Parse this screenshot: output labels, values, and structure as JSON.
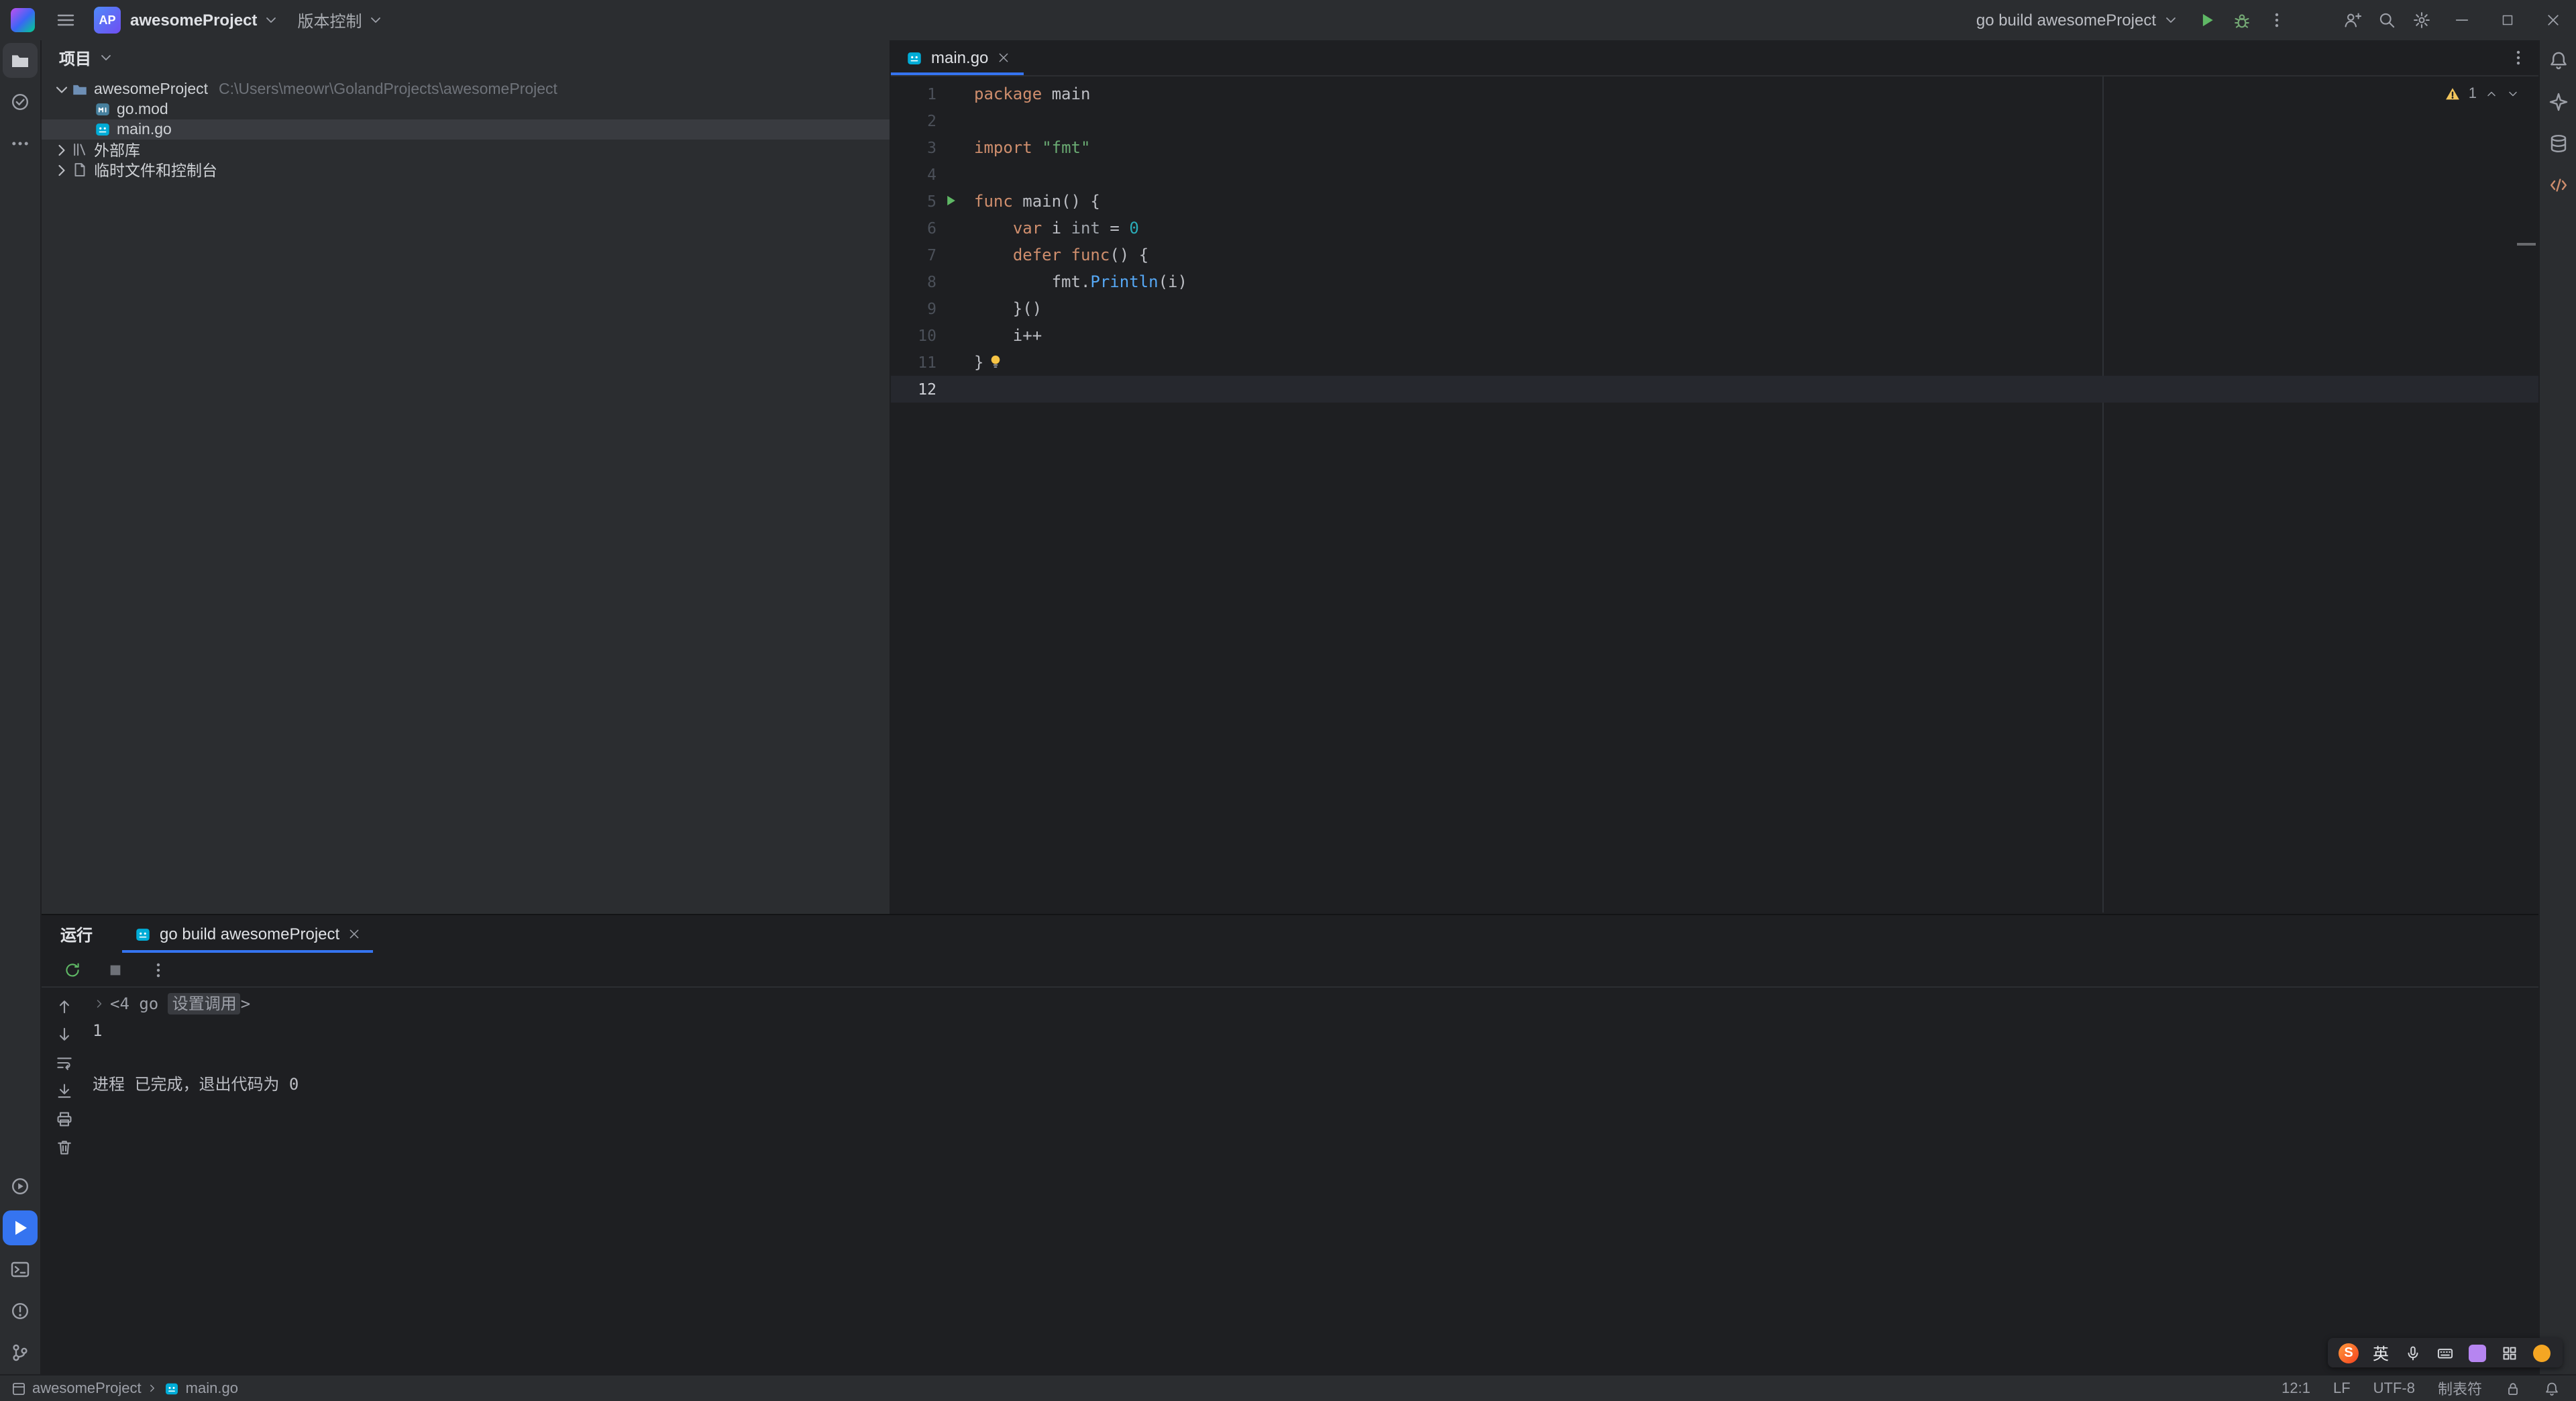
{
  "colors": {
    "accent": "#3574f0",
    "run_green": "#5fb865",
    "warning": "#f2c55c",
    "go_cyan": "#00acd7",
    "selection": "#393b40"
  },
  "title_bar": {
    "project_badge": "AP",
    "project_name": "awesomeProject",
    "vcs_label": "版本控制",
    "run_config_label": "go build awesomeProject",
    "left_icons": [
      "goland-logo",
      "hamburger-icon",
      "chevron-down-icon"
    ],
    "right_icons": [
      "run-icon",
      "debug-icon",
      "more-vertical-icon",
      "code-with-me-icon",
      "search-icon",
      "settings-icon",
      "minimize-icon",
      "maximize-icon",
      "close-icon"
    ]
  },
  "left_toolbar": {
    "top": [
      {
        "icon": "project-folder-icon",
        "active": true
      },
      {
        "icon": "commit-icon",
        "active": false
      },
      {
        "icon": "more-horizontal-icon",
        "active": false
      }
    ],
    "bottom": [
      {
        "icon": "services-icon",
        "active": false
      },
      {
        "icon": "run-icon",
        "active": true,
        "accent": true
      },
      {
        "icon": "terminal-icon",
        "active": false
      },
      {
        "icon": "problems-icon",
        "active": false
      },
      {
        "icon": "git-icon",
        "active": false
      }
    ]
  },
  "right_toolbar": [
    {
      "icon": "notifications-icon"
    },
    {
      "icon": "ai-assistant-icon"
    },
    {
      "icon": "database-icon"
    },
    {
      "icon": "endpoints-icon"
    }
  ],
  "project_panel": {
    "header": "项目",
    "tree": [
      {
        "depth": 0,
        "chevron": "down",
        "icon": "folder-icon",
        "label": "awesomeProject",
        "path": "C:\\Users\\meowr\\GolandProjects\\awesomeProject",
        "selected": false
      },
      {
        "depth": 1,
        "chevron": "",
        "icon": "go-mod-icon",
        "label": "go.mod",
        "path": "",
        "selected": false
      },
      {
        "depth": 1,
        "chevron": "",
        "icon": "go-file-icon",
        "label": "main.go",
        "path": "",
        "selected": true
      },
      {
        "depth": 0,
        "chevron": "right",
        "icon": "library-icon",
        "label": "外部库",
        "path": "",
        "selected": false
      },
      {
        "depth": 0,
        "chevron": "right",
        "icon": "scratches-icon",
        "label": "临时文件和控制台",
        "path": "",
        "selected": false
      }
    ]
  },
  "editor": {
    "tab": {
      "icon": "go-file-icon",
      "label": "main.go",
      "close_icon": "close-icon"
    },
    "inspect_widget": {
      "warning_icon": "warning-icon",
      "warning_count": "1"
    },
    "caret_line": 12,
    "code": [
      {
        "n": 1,
        "tok": [
          [
            "kw",
            "package"
          ],
          [
            "pl",
            " main"
          ]
        ]
      },
      {
        "n": 2,
        "tok": []
      },
      {
        "n": 3,
        "tok": [
          [
            "kw",
            "import"
          ],
          [
            "pl",
            " "
          ],
          [
            "str",
            "\"fmt\""
          ]
        ]
      },
      {
        "n": 4,
        "tok": []
      },
      {
        "n": 5,
        "run": true,
        "tok": [
          [
            "kw",
            "func"
          ],
          [
            "pl",
            " main() {"
          ]
        ]
      },
      {
        "n": 6,
        "tok": [
          [
            "pl",
            "    "
          ],
          [
            "kw",
            "var"
          ],
          [
            "pl",
            " i "
          ],
          [
            "ty",
            "int"
          ],
          [
            "pl",
            " = "
          ],
          [
            "num",
            "0"
          ]
        ]
      },
      {
        "n": 7,
        "tok": [
          [
            "pl",
            "    "
          ],
          [
            "kw",
            "defer"
          ],
          [
            "pl",
            " "
          ],
          [
            "kw",
            "func"
          ],
          [
            "pl",
            "() {"
          ]
        ]
      },
      {
        "n": 8,
        "tok": [
          [
            "pl",
            "        fmt."
          ],
          [
            "fn",
            "Println"
          ],
          [
            "pl",
            "(i)"
          ]
        ]
      },
      {
        "n": 9,
        "tok": [
          [
            "pl",
            "    }()"
          ]
        ]
      },
      {
        "n": 10,
        "tok": [
          [
            "pl",
            "    i++"
          ]
        ]
      },
      {
        "n": 11,
        "bulb": true,
        "tok": [
          [
            "pl",
            "}"
          ]
        ]
      },
      {
        "n": 12,
        "current": true,
        "tok": []
      }
    ]
  },
  "run_panel": {
    "title": "运行",
    "tab": {
      "icon": "go-file-icon",
      "label": "go build awesomeProject",
      "close_icon": "close-icon"
    },
    "toolbar": [
      {
        "icon": "rerun-icon",
        "color": "#5fb865"
      },
      {
        "icon": "stop-icon",
        "color": "#6e7178"
      },
      {
        "icon": "more-vertical-icon",
        "color": "#9da0a8"
      }
    ],
    "gutter_icons": [
      "up-icon",
      "down-icon",
      "softwrap-icon",
      "scroll-end-icon",
      "print-icon",
      "clear-icon"
    ],
    "console": [
      {
        "type": "fold",
        "prefix": "<4 go ",
        "folded": "设置调用",
        "suffix": ">"
      },
      {
        "type": "out",
        "text": "1"
      },
      {
        "type": "blank",
        "text": ""
      },
      {
        "type": "sys",
        "text": "进程 已完成，退出代码为 0"
      }
    ]
  },
  "status_bar": {
    "breadcrumb": [
      {
        "icon": "module-icon",
        "label": "awesomeProject"
      },
      {
        "icon": "go-file-icon",
        "label": "main.go"
      }
    ],
    "caret": "12:1",
    "line_ending": "LF",
    "encoding": "UTF-8",
    "indent": "制表符",
    "right_icons": [
      "lock-icon",
      "notifications-icon"
    ]
  },
  "ime_bar": {
    "logo": "S",
    "lang": "英",
    "icons": [
      "mic-icon",
      "keyboard-icon",
      "skin-icon",
      "grid-icon",
      "emoji-icon"
    ]
  }
}
